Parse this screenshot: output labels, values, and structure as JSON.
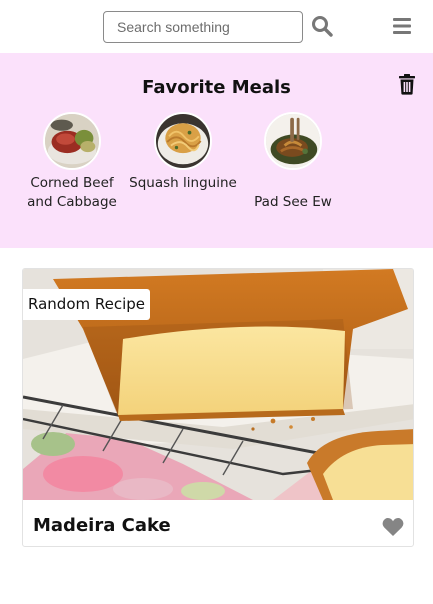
{
  "header": {
    "search_placeholder": "Search something",
    "icons": {
      "search": "search-icon",
      "menu": "hamburger-menu-icon"
    }
  },
  "favorites": {
    "title": "Favorite Meals",
    "clear_icon": "trash-icon",
    "items": [
      {
        "label": "Corned Beef and Cabbage"
      },
      {
        "label": "Squash linguine"
      },
      {
        "label": "Pad See Ew"
      }
    ]
  },
  "random": {
    "tag": "Random Recipe",
    "title": "Madeira Cake",
    "favorite_icon": "heart-icon"
  },
  "colors": {
    "favorites_background": "#fbe1fb",
    "icon_gray": "#7a7a7a"
  }
}
